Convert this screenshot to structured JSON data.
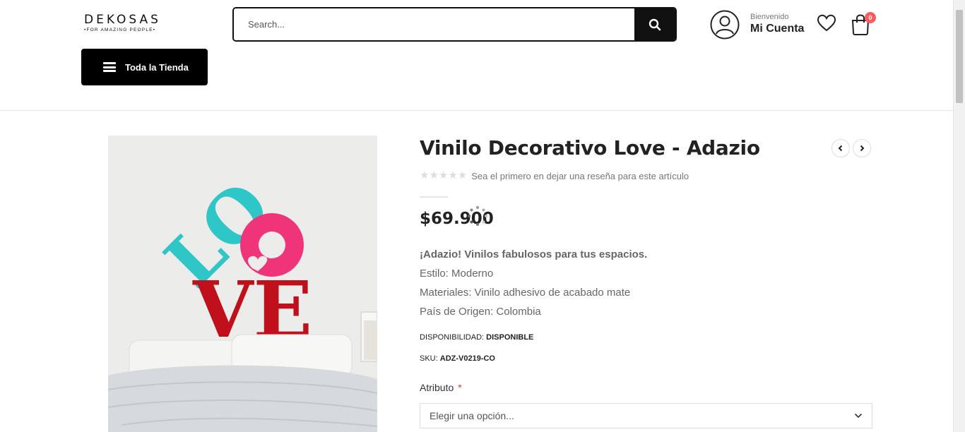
{
  "header": {
    "logo": {
      "name": "DEKOSAS",
      "tagline": "•FOR AMAZING PEOPLE•"
    },
    "search": {
      "placeholder": "Search..."
    },
    "account": {
      "greeting": "Bienvenido",
      "label": "Mi Cuenta"
    },
    "cart": {
      "count": "0"
    },
    "shop_button": "Toda la Tienda"
  },
  "product": {
    "title": "Vinilo Decorativo Love - Adazio",
    "rating": {
      "stars": 0,
      "max": 5,
      "review_text": "Sea el primero en dejar una reseña para este artículo"
    },
    "price": "$69.900",
    "description": {
      "lead": "¡Adazio! Vinilos fabulosos para tus espacios.",
      "lines": [
        "Estilo: Moderno",
        "Materiales: Vinilo adhesivo de acabado mate",
        "País de Origen: Colombia"
      ]
    },
    "availability": {
      "label": "DISPONIBILIDAD:",
      "value": "DISPONIBLE"
    },
    "sku": {
      "label": "SKU:",
      "value": "ADZ-V0219-CO"
    },
    "attribute": {
      "label": "Atributo",
      "required_mark": "*",
      "selected": "Elegir una opción..."
    },
    "image_text": {
      "top": "LO",
      "bottom": "VE"
    }
  },
  "colors": {
    "accent": "#111111",
    "badge": "#ff5b5b",
    "love_teal": "#2ec6c6",
    "love_pink": "#f0347a",
    "love_red": "#c0101c"
  }
}
